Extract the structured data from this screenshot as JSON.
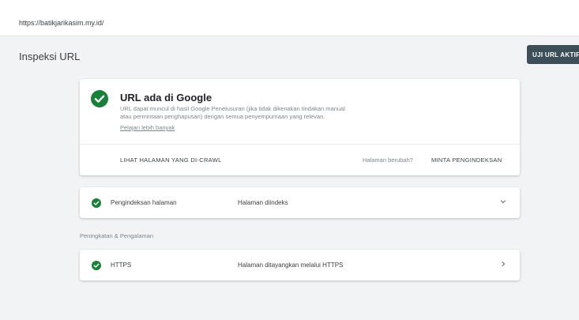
{
  "url_bar": {
    "url": "https://batikjarikasim.my.id/"
  },
  "header": {
    "title": "Inspeksi URL",
    "live_test_label": "UJI URL AKTIF"
  },
  "colors": {
    "success": "#188038",
    "button_bg": "#3c4f58",
    "page_bg": "#f1f3f4"
  },
  "status_card": {
    "icon": "check-circle-icon",
    "title": "URL ada di Google",
    "description_line1": "URL dapat muncul di hasil Google Penelusuran (jika tidak dikenakan tindakan manual",
    "description_line2": "atau permintaan penghapusan) dengan semua penyempurnaan yang relevan.",
    "learn_more": "Pelajari lebih banyak",
    "view_crawled": "LIHAT HALAMAN YANG DI-CRAWL",
    "page_changed": "Halaman berubah?",
    "request_indexing": "MINTA PENGINDEKSAN"
  },
  "indexing_row": {
    "icon": "check-circle-icon",
    "label": "Pengindeksan halaman",
    "value": "Halaman diindeks",
    "chevron": "chevron-down-icon"
  },
  "enhancements": {
    "section_label": "Peningkatan & Pengalaman",
    "https_row": {
      "icon": "check-circle-icon",
      "label": "HTTPS",
      "value": "Halaman ditayangkan melalui HTTPS",
      "chevron": "chevron-right-icon"
    }
  }
}
